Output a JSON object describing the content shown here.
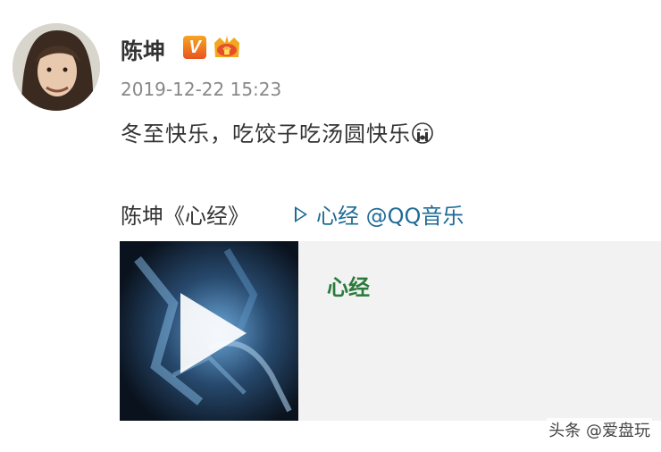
{
  "post": {
    "username": "陈坤",
    "verified_badge": "V",
    "timestamp": "2019-12-22 15:23",
    "text": "冬至快乐，吃饺子吃汤圆快乐",
    "share_prefix": "陈坤《心经》",
    "share_link": "心经 @QQ音乐"
  },
  "card": {
    "title": "心经"
  },
  "watermark": "头条 @爱盘玩",
  "icons": {
    "avatar": "avatar",
    "verified": "verified-v-icon",
    "member": "crown-member-icon",
    "emoji": "crying-face-emoji-icon",
    "play_small": "play-icon",
    "play_large": "play-button-icon"
  },
  "colors": {
    "link": "#1e6b96",
    "card_title": "#2a7a3b",
    "timestamp": "#888888"
  }
}
